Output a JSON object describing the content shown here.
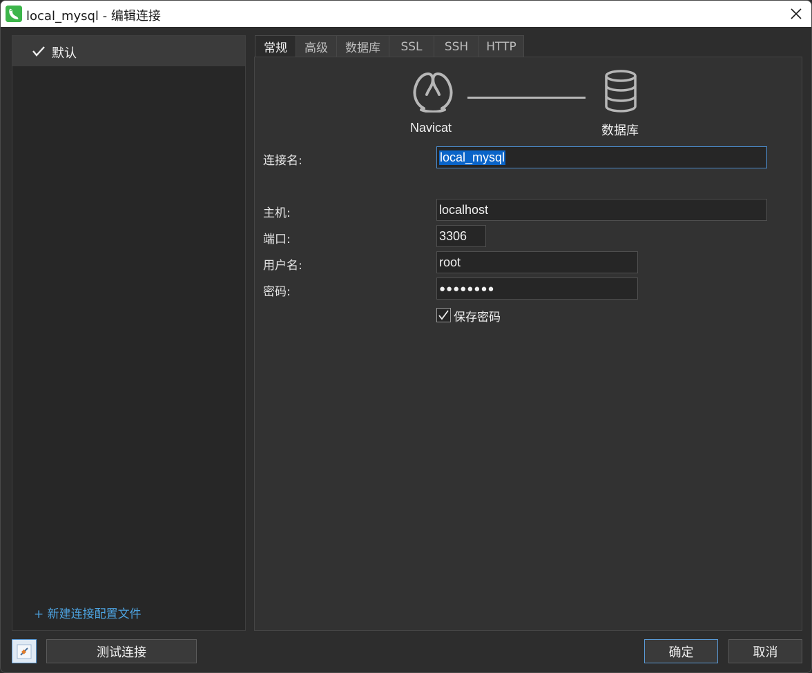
{
  "window": {
    "title": "local_mysql - 编辑连接",
    "icons": {
      "app": "navicat-dolphin-icon",
      "close": "close-icon"
    }
  },
  "left_panel": {
    "profiles": [
      {
        "label": "默认",
        "active": true,
        "icon": "check-icon"
      }
    ],
    "new_profile_link": "+ 新建连接配置文件"
  },
  "tabs": [
    {
      "label": "常规",
      "active": true
    },
    {
      "label": "高级",
      "active": false
    },
    {
      "label": "数据库",
      "active": false
    },
    {
      "label": "SSL",
      "active": false
    },
    {
      "label": "SSH",
      "active": false
    },
    {
      "label": "HTTP",
      "active": false
    }
  ],
  "diagram": {
    "left_caption": "Navicat",
    "right_caption": "数据库",
    "icons": {
      "left": "navicat-logo-icon",
      "right": "database-icon"
    }
  },
  "form": {
    "connection_name": {
      "label": "连接名:",
      "value": "local_mysql"
    },
    "host": {
      "label": "主机:",
      "value": "localhost"
    },
    "port": {
      "label": "端口:",
      "value": "3306"
    },
    "username": {
      "label": "用户名:",
      "value": "root"
    },
    "password": {
      "label": "密码:",
      "value": "●●●●●●●●"
    },
    "save_password": {
      "label": "保存密码",
      "checked": true
    }
  },
  "buttons": {
    "test_connection": "测试连接",
    "ok": "确定",
    "cancel": "取消"
  },
  "colors": {
    "accent": "#0a64c8",
    "link": "#4da3e0",
    "app_icon": "#3cb54a"
  }
}
